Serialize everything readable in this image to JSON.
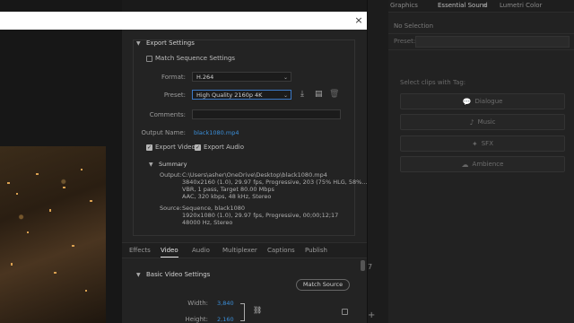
{
  "right_panel": {
    "tabs": [
      "Graphics",
      "Essential Sound",
      "Lumetri Color"
    ],
    "tab_menu_icon": "menu-lines-icon",
    "no_selection": "No Selection",
    "preset_label": "Preset:",
    "select_clips": "Select clips with Tag:",
    "tags": [
      {
        "label": "Dialogue",
        "icon": "speech-bubble-icon"
      },
      {
        "label": "Music",
        "icon": "music-note-icon"
      },
      {
        "label": "SFX",
        "icon": "sparkle-icon"
      },
      {
        "label": "Ambience",
        "icon": "ambience-icon"
      }
    ]
  },
  "mid_strip": {
    "number": "7"
  },
  "dialog": {
    "close": "×",
    "export_settings": {
      "title": "Export Settings",
      "match_sequence": "Match Sequence Settings",
      "format_label": "Format:",
      "format_value": "H.264",
      "preset_label": "Preset:",
      "preset_value": "High Quality 2160p 4K",
      "comments_label": "Comments:",
      "comments_value": "",
      "output_name_label": "Output Name:",
      "output_name_value": "black1080.mp4",
      "export_video": "Export Video",
      "export_audio": "Export Audio",
      "summary_title": "Summary",
      "output_label": "Output:",
      "output_lines": [
        "C:\\Users\\asher\\OneDrive\\Desktop\\black1080.mp4",
        "3840x2160 (1.0), 29.97 fps, Progressive, 203 (75% HLG, 58%...",
        "VBR, 1 pass, Target 80.00 Mbps",
        "AAC, 320 kbps, 48 kHz, Stereo"
      ],
      "source_label": "Source:",
      "source_lines": [
        "Sequence, black1080",
        "1920x1080 (1.0), 29.97 fps, Progressive, 00;00;12;17",
        "48000 Hz, Stereo"
      ]
    },
    "tabs": [
      "Effects",
      "Video",
      "Audio",
      "Multiplexer",
      "Captions",
      "Publish"
    ],
    "active_tab": "Video",
    "basic_video": {
      "title": "Basic Video Settings",
      "match_source": "Match Source",
      "width_label": "Width:",
      "width_value": "3,840",
      "height_label": "Height:",
      "height_value": "2,160"
    }
  }
}
